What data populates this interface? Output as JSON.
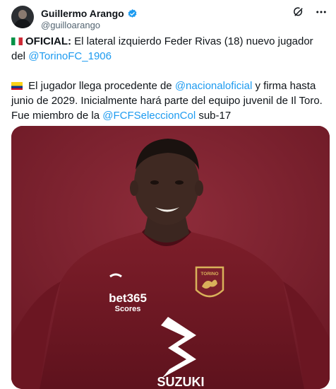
{
  "tweet": {
    "author_name": "Guillermo Arango",
    "author_handle": "@guilloarango",
    "paragraph1": {
      "flag": "italy-flag",
      "bold_label": "OFICIAL:",
      "text": " El lateral izquierdo Feder Rivas (18) nuevo jugador del ",
      "mention": "@TorinoFC_1906"
    },
    "paragraph2": {
      "flag": "colombia-flag",
      "text_a": " El jugador llega procedente de ",
      "mention_a": "@nacionaloficial",
      "text_b": " y firma hasta junio de 2029. Inicialmente hará parte del equipo juvenil de Il Toro. Fue miembro de la ",
      "mention_b": "@FCFSeleccionCol",
      "text_c": " sub-17"
    },
    "media": {
      "jersey_sponsor": "bet365",
      "jersey_sponsor_sub": "Scores",
      "jersey_brand": "SUZUKI",
      "crest_text": "TORINO",
      "background_color": "#7b1f2b"
    }
  },
  "icons": [
    "verified-badge-icon",
    "grok-icon",
    "more-options-icon"
  ]
}
